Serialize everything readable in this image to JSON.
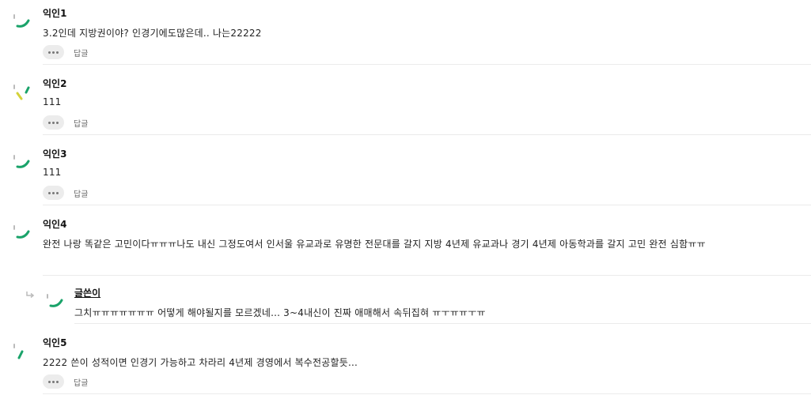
{
  "reply_label": "답글",
  "comments": [
    {
      "author": "익인1",
      "text": "3.2인데 지방권이야? 인경기에도많은데.. 나는22222"
    },
    {
      "author": "익인2",
      "text": "111"
    },
    {
      "author": "익인3",
      "text": "111"
    },
    {
      "author": "익인4",
      "text": "완전 나랑 똑같은 고민이다ㅠㅠㅠ나도 내신 그정도여서 인서울 유교과로 유명한 전문대를 갈지 지방 4년제 유교과나 경기 4년제 아동학과를 갈지 고민 완전 심함ㅠㅠ"
    },
    {
      "author": "글쓴이",
      "text": "그치ㅠㅠㅠㅠㅠㅠㅠ 어떻게 해야될지를 모르겠네... 3~4내신이 진짜 애매해서 속뒤집혀 ㅠㅜㅠㅠㅜㅠ"
    },
    {
      "author": "익인5",
      "text": "2222 쓴이 성적이면 인경기 가능하고 차라리 4년제 경영에서 복수전공할듯..."
    }
  ]
}
